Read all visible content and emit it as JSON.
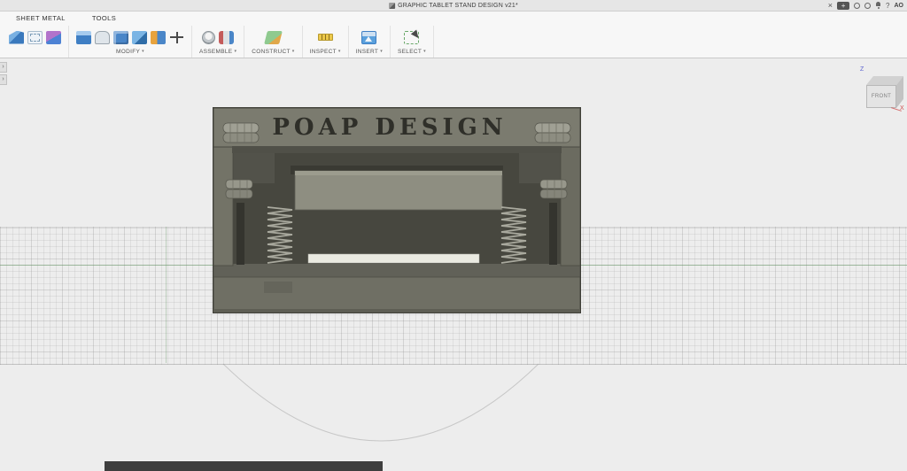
{
  "titlebar": {
    "title": "GRAPHIC TABLET STAND DESIGN v21*",
    "close_glyph": "×",
    "add_glyph": "+",
    "help_glyph": "?",
    "avatar_initials": "AO"
  },
  "tabs": {
    "sheet_metal": "SHEET METAL",
    "tools": "TOOLS"
  },
  "toolbar": {
    "caret": "▾",
    "groups": {
      "modify": "MODIFY",
      "assemble": "ASSEMBLE",
      "construct": "CONSTRUCT",
      "inspect": "INSPECT",
      "insert": "INSERT",
      "select": "SELECT"
    }
  },
  "left_panel": {
    "toggle_glyph": "›"
  },
  "viewport": {
    "engraving": "POAP DESIGN",
    "viewcube": {
      "front": "FRONT",
      "z": "Z",
      "x": "X"
    }
  },
  "icons": [
    "app-logo",
    "close",
    "add",
    "status-circle",
    "sync-circle",
    "notification-bell",
    "help",
    "avatar",
    "flange",
    "convert-to-sheet-metal",
    "new-body",
    "press-pull",
    "fillet",
    "shell",
    "combine",
    "split-body",
    "move",
    "new-component",
    "joint",
    "construct-plane",
    "measure",
    "insert-image",
    "select-cursor",
    "panel-toggle",
    "view-cube"
  ],
  "colors": {
    "model_body": "#6f6f64",
    "model_cavity": "#47473f",
    "model_tray": "#8e8e81",
    "engraving": "#2f2f29",
    "grid_green": "#6ea06e",
    "axis_x": "#d05050",
    "axis_z": "#5c63cf"
  }
}
